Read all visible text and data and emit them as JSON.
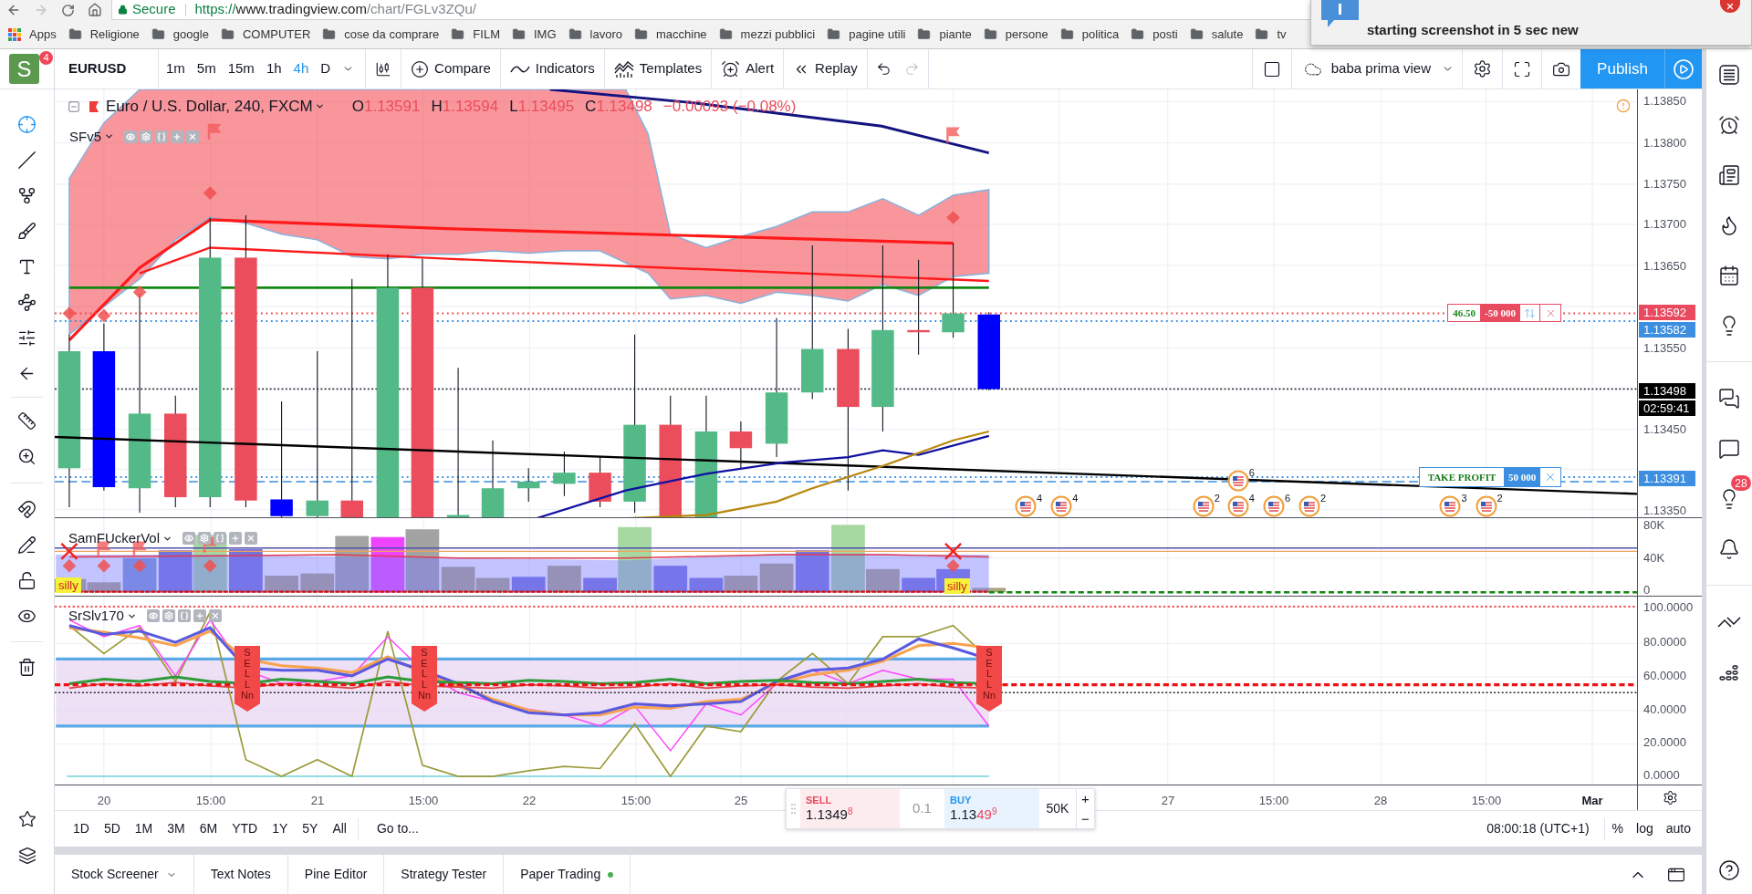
{
  "browser": {
    "url_scheme": "https://",
    "url_host": "www.tradingview.com",
    "url_path": "/chart/FGLv3ZQu/",
    "security_label": "Secure",
    "bookmarks": [
      {
        "label": "Apps",
        "kind": "apps"
      },
      {
        "label": "Religione",
        "kind": "folder"
      },
      {
        "label": "google",
        "kind": "folder"
      },
      {
        "label": "COMPUTER",
        "kind": "folder"
      },
      {
        "label": "cose da comprare",
        "kind": "folder"
      },
      {
        "label": "FILM",
        "kind": "folder"
      },
      {
        "label": "IMG",
        "kind": "folder"
      },
      {
        "label": "lavoro",
        "kind": "folder"
      },
      {
        "label": "macchine",
        "kind": "folder"
      },
      {
        "label": "mezzi pubblici",
        "kind": "folder"
      },
      {
        "label": "pagine utili",
        "kind": "folder"
      },
      {
        "label": "piante",
        "kind": "folder"
      },
      {
        "label": "persone",
        "kind": "folder"
      },
      {
        "label": "politica",
        "kind": "folder"
      },
      {
        "label": "posti",
        "kind": "folder"
      },
      {
        "label": "salute",
        "kind": "folder"
      },
      {
        "label": "tv",
        "kind": "folder"
      }
    ]
  },
  "notification": {
    "message": "starting screenshot in 5 sec new"
  },
  "toolbar": {
    "avatar": "S",
    "avatar_badge": "4",
    "symbol": "EURUSD",
    "intervals": [
      {
        "label": "1m",
        "selected": false
      },
      {
        "label": "5m",
        "selected": false
      },
      {
        "label": "15m",
        "selected": false
      },
      {
        "label": "1h",
        "selected": false
      },
      {
        "label": "4h",
        "selected": true
      },
      {
        "label": "D",
        "selected": false
      }
    ],
    "actions": [
      {
        "label": "Compare",
        "kind": "compare"
      },
      {
        "label": "Indicators",
        "kind": "indicators"
      },
      {
        "label": "Templates",
        "kind": "templates"
      },
      {
        "label": "Alert",
        "kind": "alert"
      },
      {
        "label": "Replay",
        "kind": "replay"
      }
    ],
    "layout_name": "baba prima view",
    "publish": "Publish"
  },
  "tools": [
    {
      "selected": true
    },
    {
      "selected": false
    },
    {
      "selected": false
    },
    {
      "selected": false
    },
    {
      "selected": false
    },
    {
      "selected": false
    },
    {
      "selected": false
    },
    {
      "selected": false
    },
    {
      "selected": false
    },
    {
      "selected": false
    },
    {
      "selected": false
    },
    {
      "selected": false
    },
    {
      "selected": false
    },
    {
      "selected": false
    },
    {
      "selected": false
    }
  ],
  "legend": {
    "title": "Euro / U.S. Dollar, 240, FXCM",
    "ohlc": [
      {
        "key": "O",
        "value": "1.13591"
      },
      {
        "key": "H",
        "value": "1.13594"
      },
      {
        "key": "L",
        "value": "1.13495"
      },
      {
        "key": "C",
        "value": "1.13498"
      }
    ],
    "change": "−0.00093 (−0.08%)",
    "study": "SFv5"
  },
  "price_axis": [
    {
      "label": "1.13850",
      "kind": "tick"
    },
    {
      "label": "1.13800",
      "kind": "tick"
    },
    {
      "label": "1.13750",
      "kind": "tick"
    },
    {
      "label": "1.13700",
      "kind": "tick"
    },
    {
      "label": "1.13650",
      "kind": "tick"
    },
    {
      "label": "1.13592",
      "kind": "tag",
      "color": "#e84a5f"
    },
    {
      "label": "1.13582",
      "kind": "tag",
      "color": "#3c8fe0"
    },
    {
      "label": "1.13550",
      "kind": "tick"
    },
    {
      "label": "1.13498",
      "kind": "tag",
      "color": "#000000"
    },
    {
      "label": "02:59:41",
      "kind": "tag",
      "color": "#000000"
    },
    {
      "label": "1.13450",
      "kind": "tick"
    },
    {
      "label": "1.13391",
      "kind": "tag",
      "color": "#3c8fe0"
    },
    {
      "label": "1.13350",
      "kind": "tick"
    }
  ],
  "orders": [
    {
      "kind": "stop",
      "pnl": "46.50",
      "quantity": "-50 000"
    },
    {
      "kind": "take_profit",
      "label": "TAKE PROFIT",
      "quantity": "50 000"
    }
  ],
  "events": [
    {
      "count": "4"
    },
    {
      "count": "4"
    },
    {
      "count": "2"
    },
    {
      "count": "6"
    },
    {
      "count": "4"
    },
    {
      "count": "6"
    },
    {
      "count": "2"
    },
    {
      "count": "3"
    },
    {
      "count": "2"
    }
  ],
  "volume_pane": {
    "name": "SamFUckerVol",
    "axis": [
      "80K",
      "40K",
      "0"
    ],
    "labels": [
      "silly",
      "silly"
    ]
  },
  "oscillator_pane": {
    "name": "SrSlv170",
    "axis": [
      "100.0000",
      "80.0000",
      "60.0000",
      "40.0000",
      "20.0000",
      "0.0000"
    ],
    "signals": [
      {
        "letters": "SELL",
        "note": "Nn"
      },
      {
        "letters": "SELL",
        "note": "Nn"
      },
      {
        "letters": "SELL",
        "note": "Nn"
      }
    ]
  },
  "time_axis": [
    {
      "label": "20",
      "kind": "day"
    },
    {
      "label": "15:00",
      "kind": "time"
    },
    {
      "label": "21",
      "kind": "day"
    },
    {
      "label": "15:00",
      "kind": "time"
    },
    {
      "label": "22",
      "kind": "day"
    },
    {
      "label": "15:00",
      "kind": "time"
    },
    {
      "label": "25",
      "kind": "day"
    },
    {
      "label": "27",
      "kind": "day"
    },
    {
      "label": "15:00",
      "kind": "time"
    },
    {
      "label": "28",
      "kind": "day"
    },
    {
      "label": "15:00",
      "kind": "time"
    },
    {
      "label": "Mar",
      "kind": "month"
    }
  ],
  "trade_panel": {
    "sell": {
      "label": "SELL",
      "price": "1.1349",
      "pip": "8"
    },
    "spread": "0.1",
    "buy": {
      "label": "BUY",
      "price": "1.13",
      "big": "49",
      "pip": "9"
    },
    "quantity": "50K",
    "increase": "+",
    "decrease": "−"
  },
  "range_bar": {
    "ranges": [
      "1D",
      "5D",
      "1M",
      "3M",
      "6M",
      "YTD",
      "1Y",
      "5Y",
      "All"
    ],
    "goto": "Go to...",
    "clock": "08:00:18 (UTC+1)",
    "scale_options": [
      "%",
      "log",
      "auto"
    ]
  },
  "bottom_tabs": [
    {
      "label": "Stock Screener",
      "kind": "menu"
    },
    {
      "label": "Text Notes",
      "kind": "plain"
    },
    {
      "label": "Pine Editor",
      "kind": "plain"
    },
    {
      "label": "Strategy Tester",
      "kind": "plain"
    },
    {
      "label": "Paper Trading",
      "kind": "connected"
    }
  ],
  "sidebar": {
    "ideas_badge": "28"
  }
}
